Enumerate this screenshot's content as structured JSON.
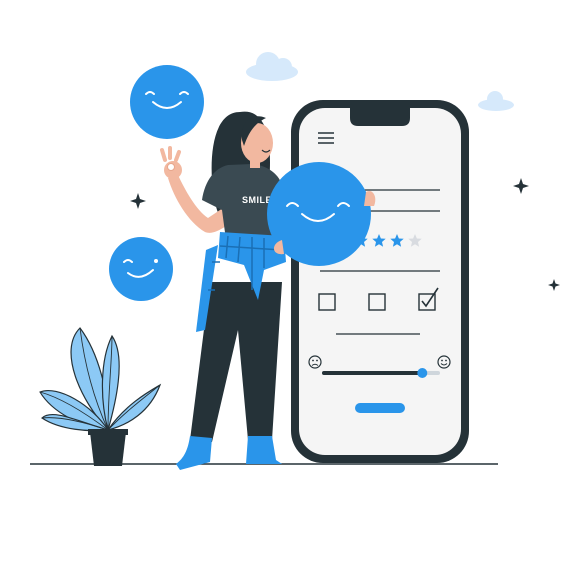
{
  "illustration": {
    "shirt_text": "SMILEY",
    "rating": {
      "filled": 4,
      "total": 5
    },
    "checkboxes": [
      {
        "checked": false
      },
      {
        "checked": false
      },
      {
        "checked": true
      }
    ],
    "slider": {
      "value": 0.85
    },
    "colors": {
      "accent": "#2a95ea",
      "accent_light": "#6cbcf3",
      "dark": "#253238",
      "phone_screen": "#f5f5f5",
      "star_empty": "#d8dbe0",
      "skin": "#f2b8a0"
    }
  }
}
